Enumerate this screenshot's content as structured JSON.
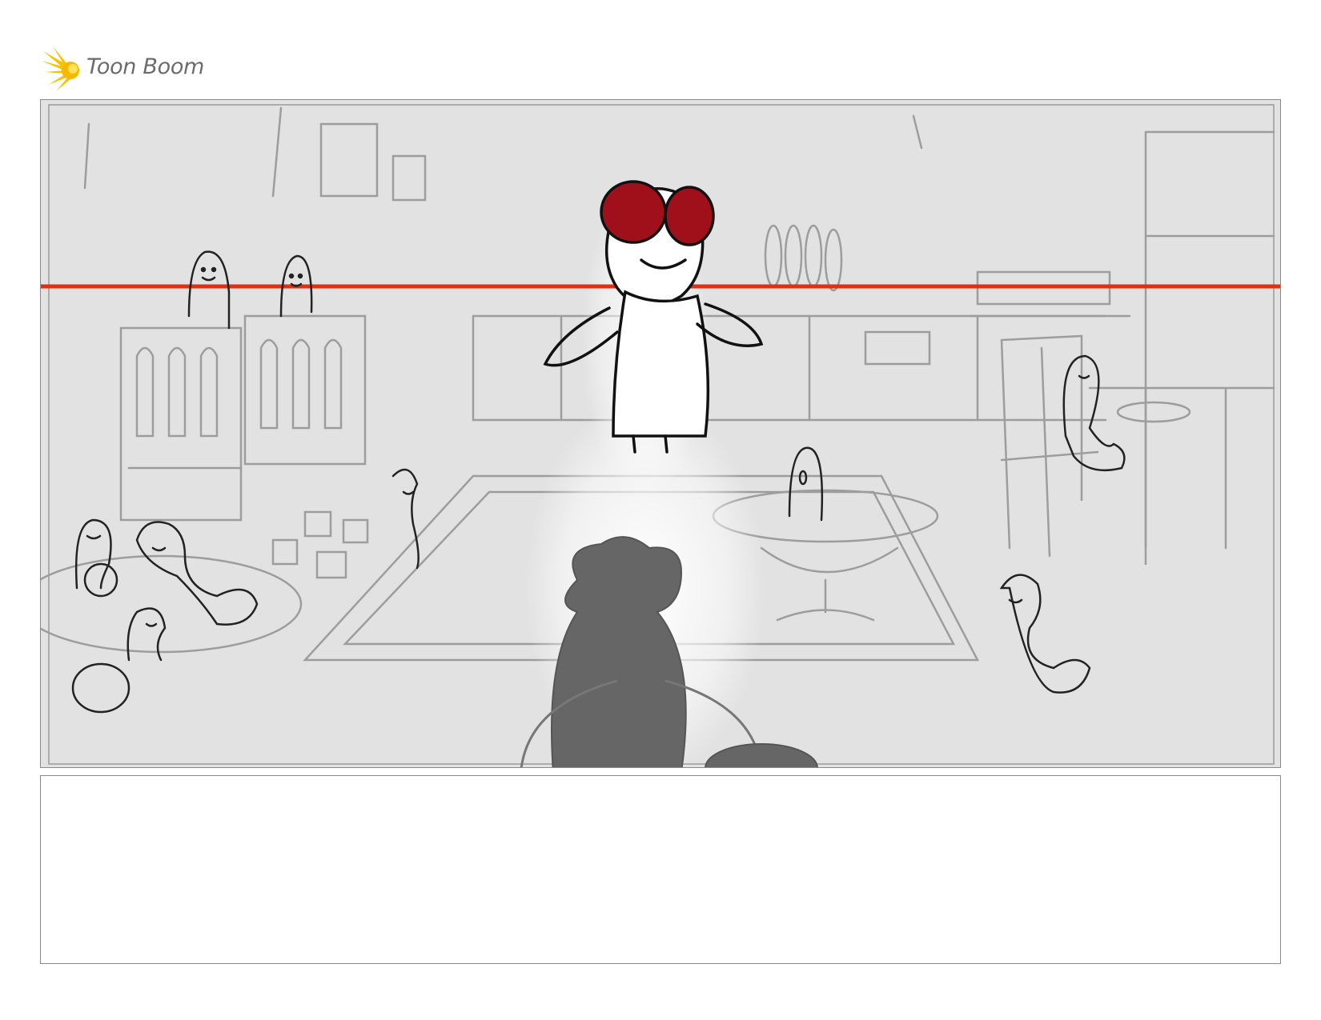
{
  "header": {
    "logo_text": "Toon Boom",
    "logo_icon": "starburst-logo-icon",
    "brand_color": "#f5c400"
  },
  "panel": {
    "background_color": "#e2e2e2",
    "horizon_line_color": "#e03010",
    "eye_color": "#a0101a",
    "silhouette_color": "#666666"
  },
  "notes": {
    "text": ""
  }
}
